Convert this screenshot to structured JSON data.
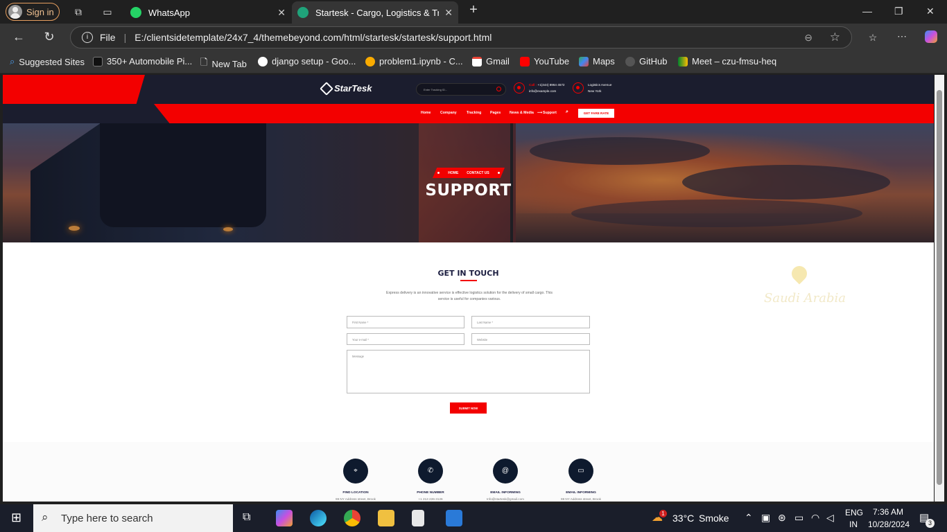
{
  "browser": {
    "sign_in": "Sign in",
    "tabs": [
      {
        "title": "WhatsApp"
      },
      {
        "title": "Startesk - Cargo, Logistics & Tran"
      }
    ],
    "address_scheme": "File",
    "url": "E:/clientsidetemplate/24x7_4/themebeyond.com/html/startesk/startesk/support.html",
    "bookmarks": [
      "Suggested Sites",
      "350+ Automobile Pi...",
      "New Tab",
      "django setup - Goo...",
      "problem1.ipynb - C...",
      "Gmail",
      "YouTube",
      "Maps",
      "GitHub",
      "Meet – czu-fmsu-heq"
    ]
  },
  "site": {
    "logo": "StarTesk",
    "tracking_placeholder": "Enter Tracking ID...",
    "header_call_label": "Call :",
    "header_phone": "+1(444) 8964 4572",
    "header_email": "info@example.com",
    "header_location_title": "Logistics Avenue",
    "header_location_sub": "New York",
    "nav": [
      "Home",
      "Company",
      "Tracking",
      "Pages",
      "News & Media",
      "Support"
    ],
    "quote_button": "GET FARE RATE",
    "breadcrumb": [
      "HOME",
      "CONTACT US"
    ],
    "hero_title": "SUPPORT",
    "section_title": "GET IN TOUCH",
    "section_desc": "Express delivery is an innovative service is effective logistics solution for the delivery of small cargo. This service is useful for companies various.",
    "form": {
      "first_name": "First Name *",
      "last_name": "Last Name *",
      "email": "Your e-mail *",
      "website": "Website",
      "message": "Message",
      "submit": "SUBMIT NOW"
    },
    "map_label": "Saudi Arabia",
    "info": [
      {
        "label": "FIND LOCATION",
        "value": "99 NY Address street, Brook"
      },
      {
        "label": "PHONE NUMBER",
        "value": "+1 212-226-3126"
      },
      {
        "label": "EMAIL INFORMING",
        "value": "Info@startesk@gmail.com"
      },
      {
        "label": "EMAIL INFORMING",
        "value": "99 NY Address street, Brook"
      }
    ]
  },
  "taskbar": {
    "search_placeholder": "Type here to search",
    "weather_temp": "33°C",
    "weather_text": "Smoke",
    "weather_badge": "1",
    "lang_top": "ENG",
    "lang_bottom": "IN",
    "time": "7:36 AM",
    "date": "10/28/2024",
    "notif_count": "3"
  },
  "colors": {
    "accent": "#f30000",
    "navy": "#1b1d2e"
  }
}
